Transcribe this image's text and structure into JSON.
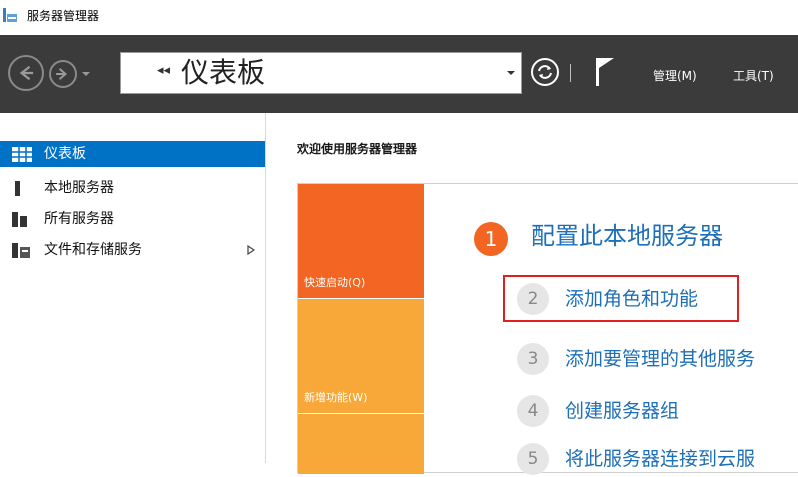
{
  "window": {
    "title": "服务器管理器"
  },
  "toolbar": {
    "address": "仪表板",
    "menu_manage": "管理(M)",
    "menu_tools": "工具(T)"
  },
  "sidebar": {
    "items": [
      {
        "label": "仪表板",
        "active": true
      },
      {
        "label": "本地服务器"
      },
      {
        "label": "所有服务器"
      },
      {
        "label": "文件和存储服务",
        "expandable": true
      }
    ]
  },
  "main": {
    "welcome": "欢迎使用服务器管理器",
    "tiles": [
      "快速启动(Q)",
      "新增功能(W)"
    ],
    "step1": {
      "num": "1",
      "text": "配置此本地服务器"
    },
    "steps": [
      {
        "num": "2",
        "text": "添加角色和功能",
        "highlighted": true
      },
      {
        "num": "3",
        "text": "添加要管理的其他服务"
      },
      {
        "num": "4",
        "text": "创建服务器组"
      },
      {
        "num": "5",
        "text": "将此服务器连接到云服"
      }
    ]
  },
  "colors": {
    "accent": "#0072c6",
    "orange": "#f26522",
    "amber": "#f7a838",
    "link": "#1d6fb7",
    "highlight": "#e02020"
  }
}
